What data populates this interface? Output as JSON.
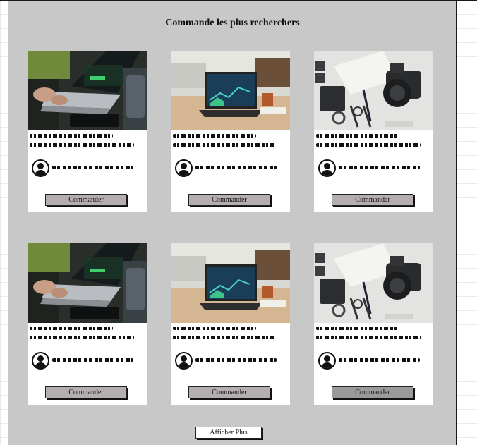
{
  "page": {
    "heading": "Commande les plus recherchers",
    "more_button": "Afficher Plus"
  },
  "cards": [
    {
      "photo": "laptop-trading-photo",
      "button": "Commander"
    },
    {
      "photo": "desk-laptop-photo",
      "button": "Commander"
    },
    {
      "photo": "camera-flatlay-photo",
      "button": "Commander"
    },
    {
      "photo": "laptop-trading-photo",
      "button": "Commander"
    },
    {
      "photo": "desk-laptop-photo",
      "button": "Commander"
    },
    {
      "photo": "camera-flatlay-photo",
      "button": "Commander"
    }
  ],
  "icons": {
    "author": "user-avatar-icon"
  },
  "colors": {
    "panel": "#c8c8c8",
    "button": "#b5aeae",
    "button_selected": "#9a9a9a"
  }
}
